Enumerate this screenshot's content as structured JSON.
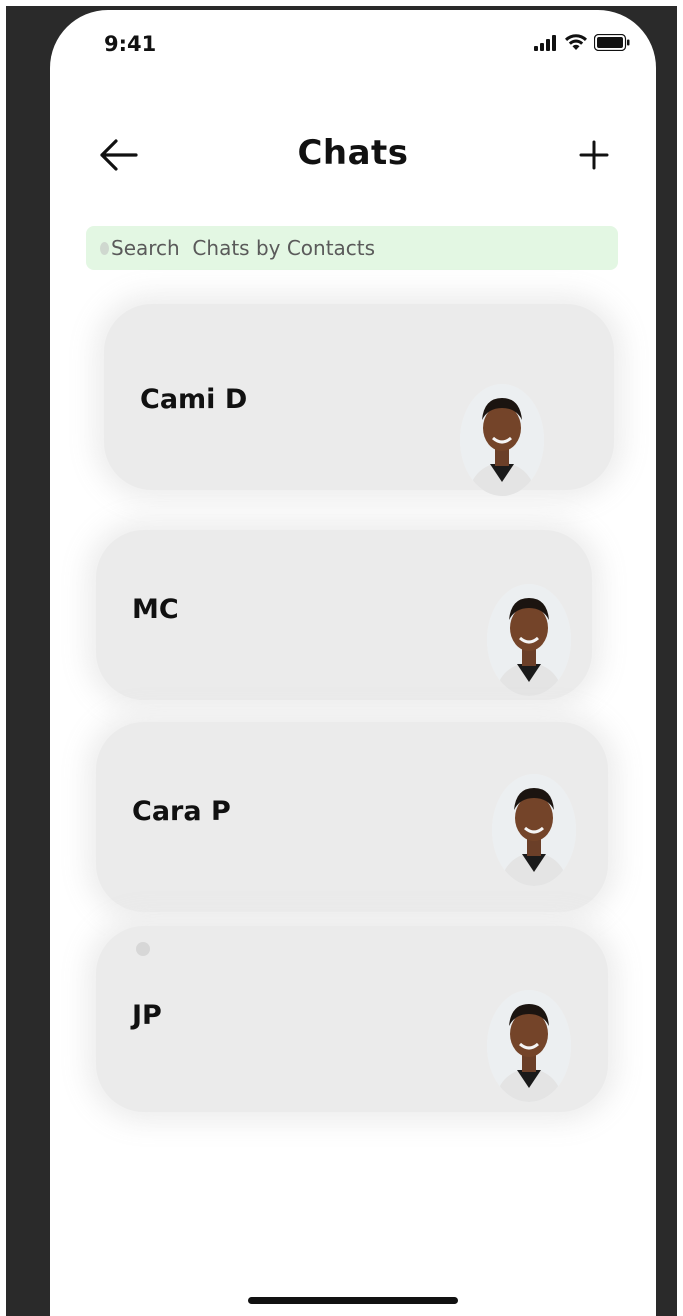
{
  "status_bar": {
    "time": "9:41"
  },
  "header": {
    "title": "Chats"
  },
  "search": {
    "placeholder": "Search  Chats by Contacts"
  },
  "chats": [
    {
      "name": "Cami D"
    },
    {
      "name": "MC"
    },
    {
      "name": "Cara P"
    },
    {
      "name": "JP"
    }
  ],
  "colors": {
    "search_background": "#e3f7e3",
    "card_background": "#ebebeb",
    "bezel": "#2a2a2a"
  },
  "icons": [
    "back-arrow-icon",
    "plus-icon",
    "signal-icon",
    "wifi-icon",
    "battery-icon",
    "avatar-photo"
  ]
}
